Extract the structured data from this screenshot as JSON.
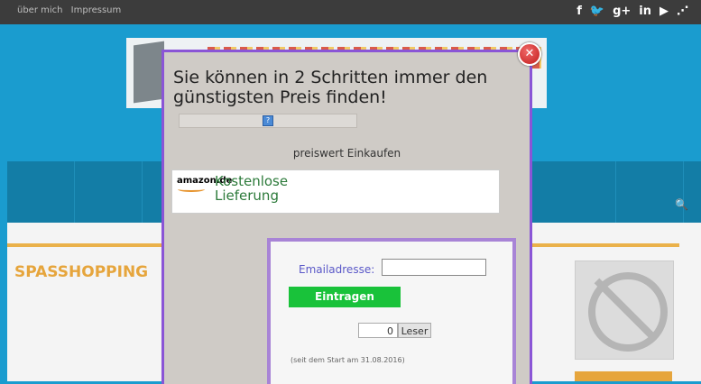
{
  "topbar": {
    "nav": [
      "über mich",
      "Impressum"
    ],
    "social": [
      {
        "icon": "facebook-icon",
        "glyph": "f"
      },
      {
        "icon": "twitter-icon",
        "glyph": "🐦"
      },
      {
        "icon": "google-plus-icon",
        "glyph": "g+"
      },
      {
        "icon": "linkedin-icon",
        "glyph": "in"
      },
      {
        "icon": "youtube-icon",
        "glyph": "▶"
      },
      {
        "icon": "rss-icon",
        "glyph": "⋰"
      }
    ]
  },
  "site": {
    "section_title": "SPASSHOPPING",
    "search_icon": "🔍"
  },
  "modal": {
    "title": "Sie können in 2 Schritten immer den günstigsten Preis finden!",
    "label": "preiswert Einkaufen",
    "amazon_logo": "amazon.de",
    "amazon_text": "Kostenlose Lieferung",
    "close": "✕",
    "form": {
      "email_label": "Emailadresse:",
      "email_value": "",
      "submit_label": "Eintragen",
      "counter_value": "0",
      "counter_label": "Leser",
      "since_text": "(seit dem Start am 31.08.2016)"
    }
  },
  "colors": {
    "accent": "#e6a53c",
    "modal_border": "#8a55d6",
    "button_green": "#19c23a"
  }
}
